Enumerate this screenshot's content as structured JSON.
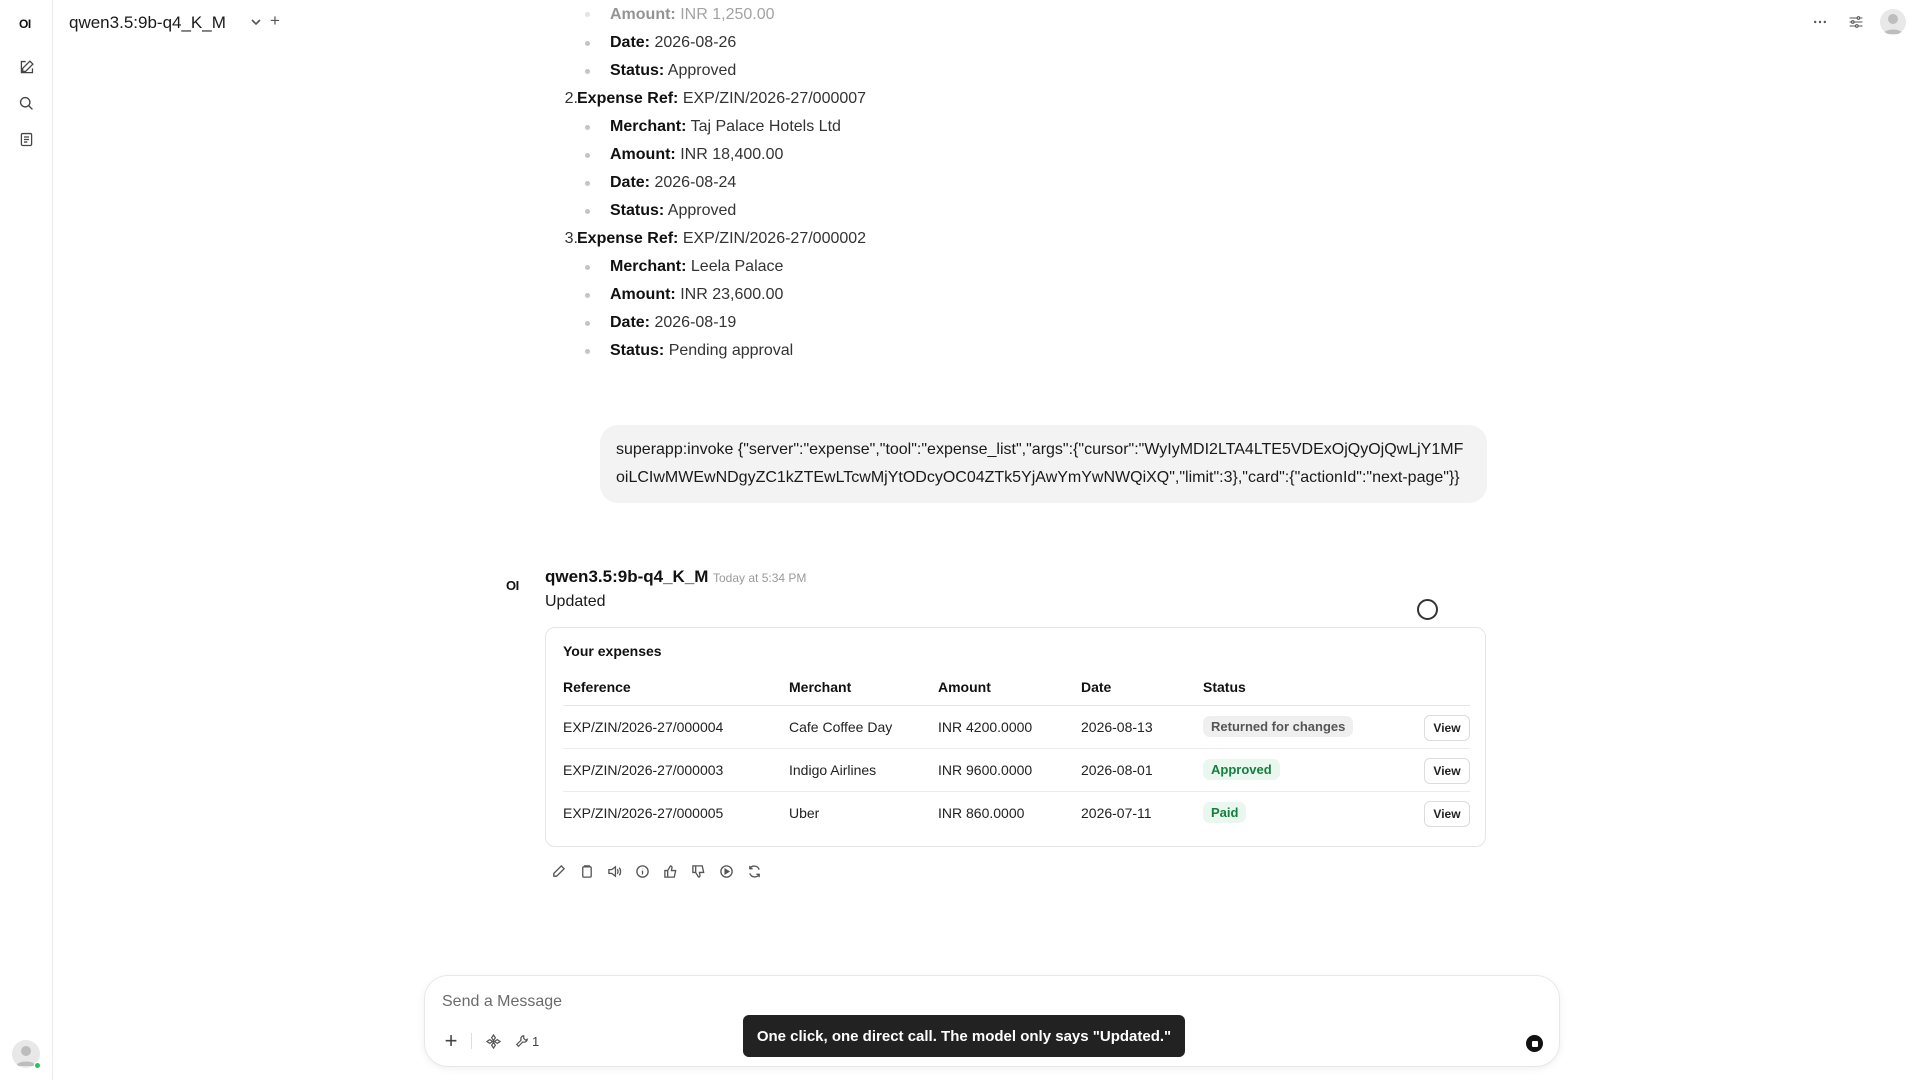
{
  "app": {
    "logo": "OI"
  },
  "header": {
    "model_name": "qwen3.5:9b-q4_K_M",
    "add_label": "+"
  },
  "sidebar": {
    "items": [
      {
        "icon": "new-chat-icon"
      },
      {
        "icon": "search-icon"
      },
      {
        "icon": "notes-icon"
      }
    ]
  },
  "expense_list": {
    "top_partial": {
      "amount_label": "Amount:",
      "amount_value": "INR 1,250.00",
      "date_label": "Date:",
      "date_value": "2026-08-26",
      "status_label": "Status:",
      "status_value": "Approved"
    },
    "items": [
      {
        "num": "2.",
        "ref_label": "Expense Ref:",
        "ref_value": "EXP/ZIN/2026-27/000007",
        "merchant_label": "Merchant:",
        "merchant_value": "Taj Palace Hotels Ltd",
        "amount_label": "Amount:",
        "amount_value": "INR 18,400.00",
        "date_label": "Date:",
        "date_value": "2026-08-24",
        "status_label": "Status:",
        "status_value": "Approved"
      },
      {
        "num": "3.",
        "ref_label": "Expense Ref:",
        "ref_value": "EXP/ZIN/2026-27/000002",
        "merchant_label": "Merchant:",
        "merchant_value": "Leela Palace",
        "amount_label": "Amount:",
        "amount_value": "INR 23,600.00",
        "date_label": "Date:",
        "date_value": "2026-08-19",
        "status_label": "Status:",
        "status_value": "Pending approval"
      }
    ]
  },
  "user_message": "superapp:invoke {\"server\":\"expense\",\"tool\":\"expense_list\",\"args\":{\"cursor\":\"WyIyMDI2LTA4LTE5VDExOjQyOjQwLjY1MFoiLCIwMWEwNDgyZC1kZTEwLTcwMjYtODcyOC04ZTk5YjAwYmYwNWQiXQ\",\"limit\":3},\"card\":{\"actionId\":\"next-page\"}}",
  "assistant": {
    "logo": "OI",
    "name": "qwen3.5:9b-q4_K_M",
    "time": "Today at 5:34 PM",
    "text": "Updated"
  },
  "expense_card": {
    "title": "Your expenses",
    "columns": [
      "Reference",
      "Merchant",
      "Amount",
      "Date",
      "Status"
    ],
    "rows": [
      {
        "reference": "EXP/ZIN/2026-27/000004",
        "merchant": "Cafe Coffee Day",
        "amount": "INR 4200.0000",
        "date": "2026-08-13",
        "status": "Returned for changes",
        "action": "View"
      },
      {
        "reference": "EXP/ZIN/2026-27/000003",
        "merchant": "Indigo Airlines",
        "amount": "INR 9600.0000",
        "date": "2026-08-01",
        "status": "Approved",
        "action": "View"
      },
      {
        "reference": "EXP/ZIN/2026-27/000005",
        "merchant": "Uber",
        "amount": "INR 860.0000",
        "date": "2026-07-11",
        "status": "Paid",
        "action": "View"
      }
    ],
    "status_colors": {
      "Returned for changes": {
        "bg": "#efefef",
        "fg": "#555555"
      },
      "Approved": {
        "bg": "#e9f7ee",
        "fg": "#15803d"
      },
      "Paid": {
        "bg": "#e9f7ee",
        "fg": "#15803d"
      }
    }
  },
  "message_actions": [
    "edit-icon",
    "copy-icon",
    "read-aloud-icon",
    "info-icon",
    "thumbs-up-icon",
    "thumbs-down-icon",
    "continue-icon",
    "regenerate-icon"
  ],
  "composer": {
    "placeholder": "Send a Message",
    "tools_count": "1"
  },
  "toast": "One click, one direct call. The model only says \"Updated.\""
}
